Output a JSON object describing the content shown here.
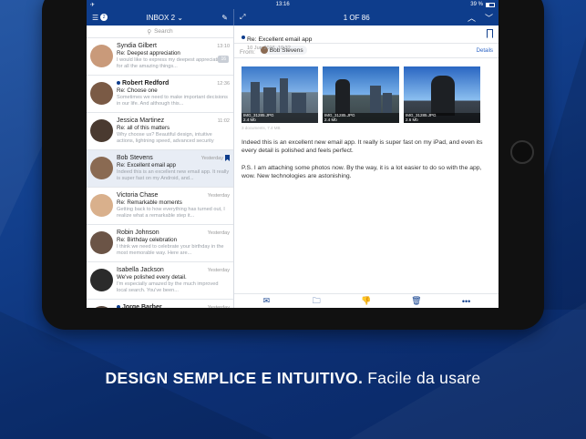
{
  "status_bar": {
    "time": "13:16",
    "battery": "39 %"
  },
  "header": {
    "mailbox": "INBOX 2",
    "mailbox_badge": "2",
    "position": "1 OF 86"
  },
  "search": {
    "placeholder": "Search"
  },
  "mails": [
    {
      "sender": "Syndia Gilbert",
      "time": "13:10",
      "subject": "Re: Deepest appreciation",
      "preview": "I would like to express my deepest appreciation for all the amazing things...",
      "count": "16",
      "unread": false,
      "avatar_color": "#c99a7a"
    },
    {
      "sender": "Robert Redford",
      "time": "12:36",
      "subject": "Re: Choose one",
      "preview": "Sometimes we need to make important decisions in our life. And although this...",
      "unread": true,
      "avatar_color": "#7a5a45"
    },
    {
      "sender": "Jessica Martinez",
      "time": "11:02",
      "subject": "Re: all of this matters",
      "preview": "Why choose us? Beautiful design, intuitive actions, lightning speed, advanced security",
      "unread": false,
      "avatar_color": "#4a3a30"
    },
    {
      "sender": "Bob Stevens",
      "time": "Yesterday",
      "subject": "Re: Excellent email app",
      "preview": "Indeed this is an excellent new email app. It really is super fast on my Android, and...",
      "unread": false,
      "avatar_color": "#8a6a52"
    },
    {
      "sender": "Victoria Chase",
      "time": "Yesterday",
      "subject": "Re: Remarkable moments",
      "preview": "Getting back to how everything has turned out, I realize what a remarkable step it...",
      "unread": false,
      "avatar_color": "#d9b08c"
    },
    {
      "sender": "Robin Johnson",
      "time": "Yesterday",
      "subject": "Re: Birthday celebration",
      "preview": "I think we need to celebrate your birthday in the most memorable way. Here are...",
      "unread": false,
      "avatar_color": "#6b5446"
    },
    {
      "sender": "Isabella Jackson",
      "time": "Yesterday",
      "subject": "We've polished every detail.",
      "preview": "I'm especially amazed by the much improved local search. You've been...",
      "unread": false,
      "avatar_color": "#2b2b2b"
    },
    {
      "sender": "Jorge Barber",
      "time": "Yesterday",
      "subject": "",
      "preview": "",
      "unread": true,
      "avatar_color": "#5a4a40"
    }
  ],
  "detail": {
    "subject": "Re: Excellent email app",
    "date": "10 Jun 2016, 10:32",
    "from_label": "From:",
    "from_name": "Bob Stevens",
    "details_link": "Details",
    "attachments": [
      {
        "name": "IMG_31285.JPG",
        "size": "2.4 Mb"
      },
      {
        "name": "IMG_31285.JPG",
        "size": "2.4 Mb"
      },
      {
        "name": "IMG_31285.JPG",
        "size": "2.6 Mb"
      }
    ],
    "attachments_meta": "3 documents, 7.4 MB",
    "paragraphs": [
      "Indeed this is an excellent new email app. It really is super fast on my iPad, and even its every detail is polished and feels perfect.",
      "P.S. I am attaching some photos now. By the way, it is a lot easier to do so with the app, wow. New technologies are astonishing."
    ]
  },
  "tagline": {
    "strong": "DESIGN SEMPLICE E INTUITIVO.",
    "normal": " Facile da usare"
  },
  "colors": {
    "brand": "#0e3d8c",
    "link": "#2c64c5"
  }
}
